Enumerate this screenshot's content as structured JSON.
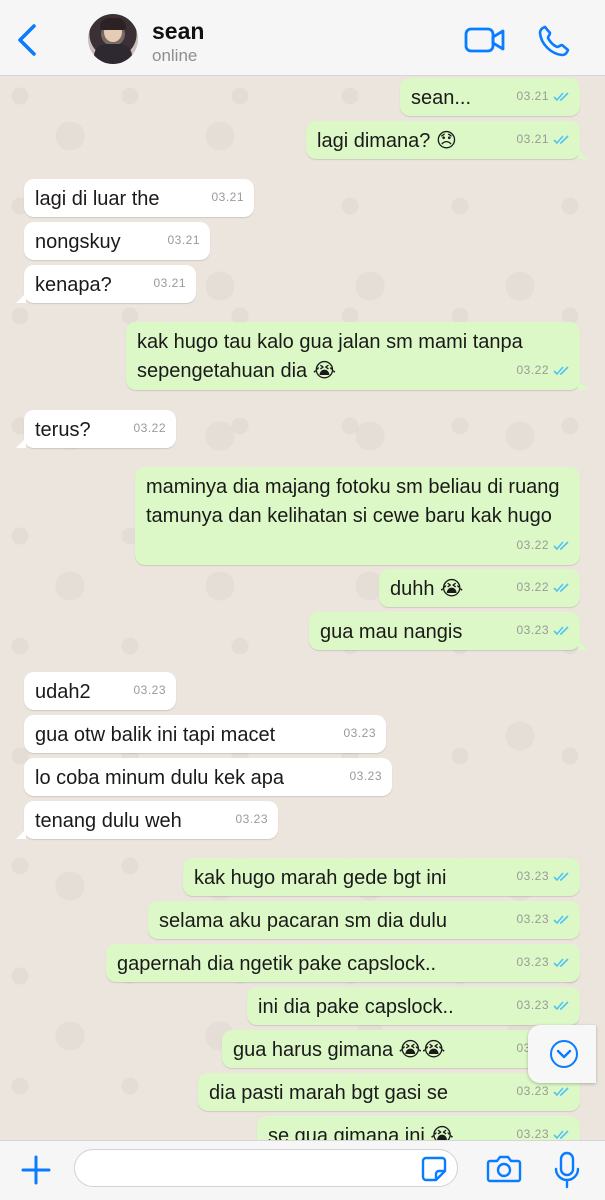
{
  "header": {
    "back_icon": "chevron-left-icon",
    "contact_name": "sean",
    "contact_status": "online",
    "video_call_icon": "video-camera-icon",
    "voice_call_icon": "phone-icon",
    "accent_color": "#0a7cff"
  },
  "messages": [
    {
      "dir": "out",
      "text": "sean...",
      "time": "03.21",
      "read": true
    },
    {
      "dir": "out",
      "text": "lagi dimana? 😞",
      "time": "03.21",
      "read": true
    },
    {
      "dir": "in",
      "text": "lagi di luar the",
      "time": "03.21"
    },
    {
      "dir": "in",
      "text": "nongskuy",
      "time": "03.21"
    },
    {
      "dir": "in",
      "text": "kenapa?",
      "time": "03.21"
    },
    {
      "dir": "out",
      "text": "kak hugo tau kalo gua jalan sm mami tanpa sepengetahuan dia 😭",
      "time": "03.22",
      "read": true
    },
    {
      "dir": "in",
      "text": "terus?",
      "time": "03.22"
    },
    {
      "dir": "out",
      "text": "maminya dia majang fotoku sm beliau di ruang tamunya dan kelihatan si cewe baru kak hugo",
      "time": "03.22",
      "read": true
    },
    {
      "dir": "out",
      "text": "duhh 😭",
      "time": "03.22",
      "read": true
    },
    {
      "dir": "out",
      "text": "gua mau nangis",
      "time": "03.23",
      "read": true
    },
    {
      "dir": "in",
      "text": "udah2",
      "time": "03.23"
    },
    {
      "dir": "in",
      "text": "gua otw balik ini tapi macet",
      "time": "03.23"
    },
    {
      "dir": "in",
      "text": "lo coba minum dulu kek apa",
      "time": "03.23"
    },
    {
      "dir": "in",
      "text": "tenang dulu weh",
      "time": "03.23"
    },
    {
      "dir": "out",
      "text": "kak hugo marah gede bgt ini",
      "time": "03.23",
      "read": true
    },
    {
      "dir": "out",
      "text": "selama aku pacaran sm dia dulu",
      "time": "03.23",
      "read": true
    },
    {
      "dir": "out",
      "text": "gapernah dia ngetik pake capslock..",
      "time": "03.23",
      "read": true
    },
    {
      "dir": "out",
      "text": "ini dia pake capslock..",
      "time": "03.23",
      "read": true
    },
    {
      "dir": "out",
      "text": "gua harus gimana 😭😭",
      "time": "03.23",
      "read": true
    },
    {
      "dir": "out",
      "text": "dia pasti marah bgt gasi se",
      "time": "03.23",
      "read": true
    },
    {
      "dir": "out",
      "text": "se gua gimana ini 😭",
      "time": "03.23",
      "read": true
    }
  ],
  "colors": {
    "outgoing_bubble": "#dcf8c6",
    "incoming_bubble": "#ffffff",
    "read_ticks": "#4fc3f7",
    "chat_background": "#ece5dd"
  },
  "composer": {
    "plus_icon": "plus-icon",
    "text_value": "",
    "sticker_icon": "sticker-icon",
    "camera_icon": "camera-icon",
    "mic_icon": "microphone-icon"
  },
  "scroll_down_icon": "chevron-down-circle-icon"
}
